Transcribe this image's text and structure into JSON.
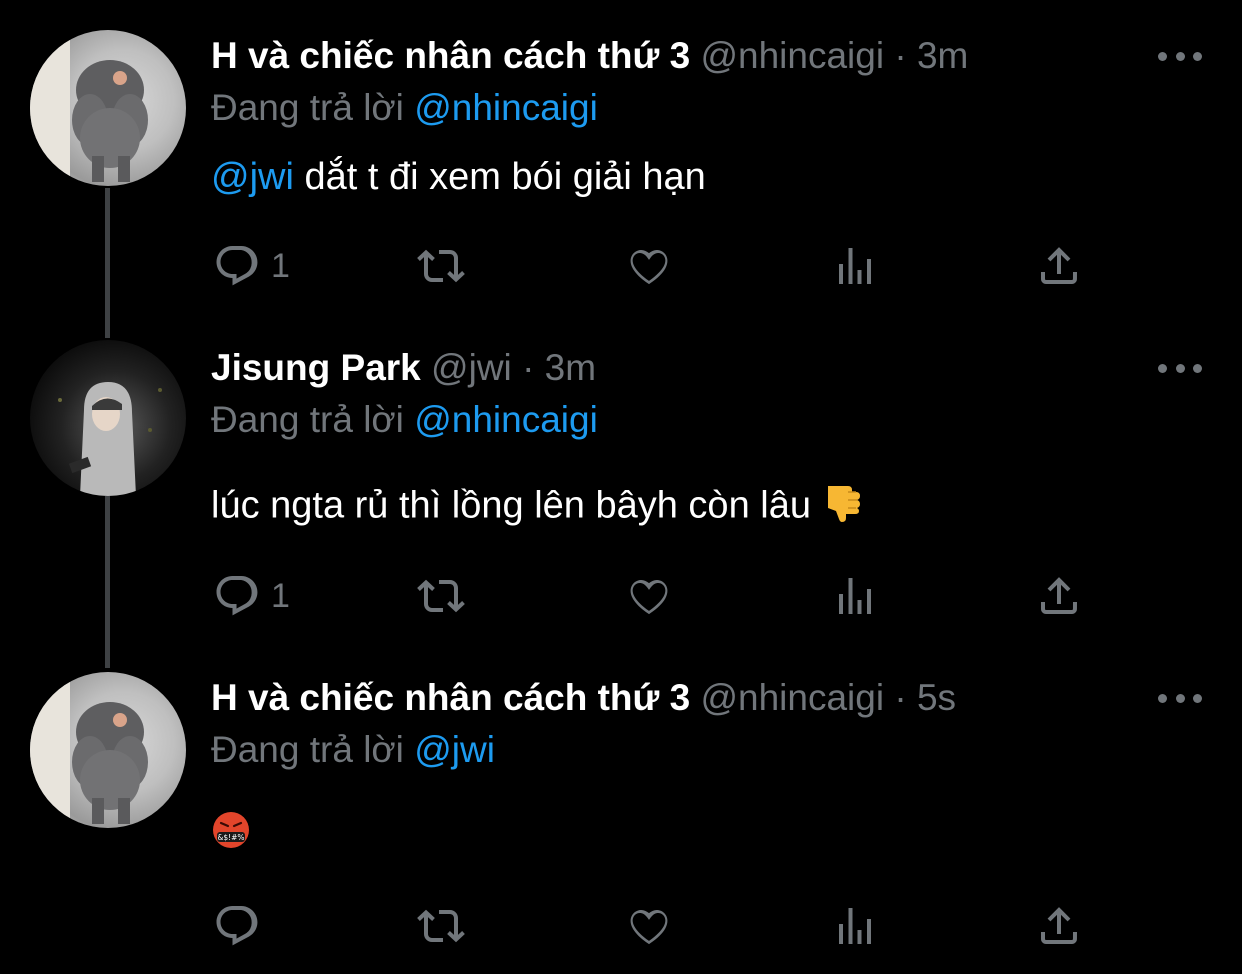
{
  "tweets": [
    {
      "name": "H và chiếc nhân cách thứ 3",
      "handle": "@nhincaigi",
      "separator": "·",
      "time": "3m",
      "reply_prefix": "Đang trả lời",
      "reply_to": "@nhincaigi",
      "mention": "@jwi",
      "text": " dắt t đi xem bói giải hạn",
      "reply_count": "1",
      "avatar_icon": "poodle-photo"
    },
    {
      "name": "Jisung Park",
      "handle": "@jwi",
      "separator": "·",
      "time": "3m",
      "reply_prefix": "Đang trả lời",
      "reply_to": "@nhincaigi",
      "text": "lúc ngta rủ thì lồng lên bâyh còn lâu",
      "emoji": "thumbs-down-emoji",
      "reply_count": "1",
      "avatar_icon": "person-in-hoodie-photo"
    },
    {
      "name": "H và chiếc nhân cách thứ 3",
      "handle": "@nhincaigi",
      "separator": "·",
      "time": "5s",
      "reply_prefix": "Đang trả lời",
      "reply_to": "@jwi",
      "emoji": "face-with-symbols-emoji",
      "emoji_text": "&$!#%",
      "reply_count": "",
      "avatar_icon": "poodle-photo"
    }
  ],
  "colors": {
    "background": "#000000",
    "text": "#ffffff",
    "muted": "#71767b",
    "accent": "#1d9bf0",
    "thread_line": "#3e4144"
  }
}
